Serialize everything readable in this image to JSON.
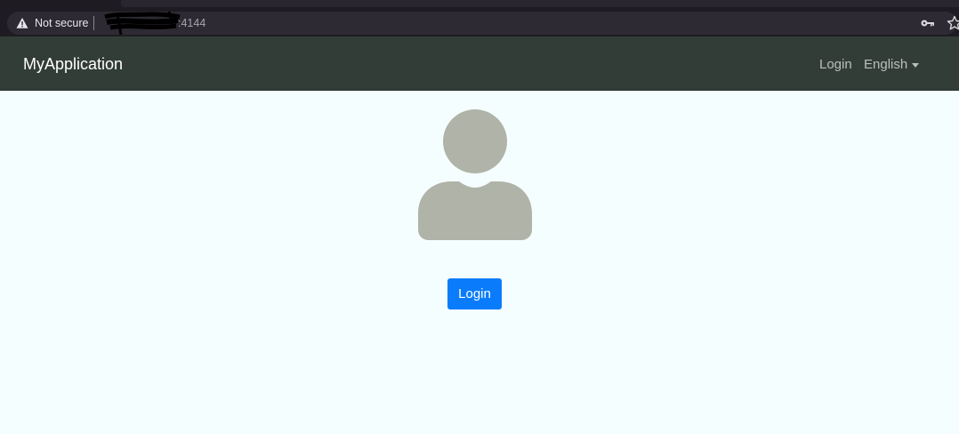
{
  "browser": {
    "security_label": "Not secure",
    "url_suffix": ":4144"
  },
  "navbar": {
    "brand": "MyApplication",
    "login_label": "Login",
    "language_label": "English"
  },
  "main": {
    "avatar_icon": "user-icon",
    "login_button_label": "Login"
  },
  "colors": {
    "navbar_bg": "#333d38",
    "page_bg": "#f5fefe",
    "button_primary": "#0a7cfb",
    "avatar_gray": "#afb3a8"
  }
}
